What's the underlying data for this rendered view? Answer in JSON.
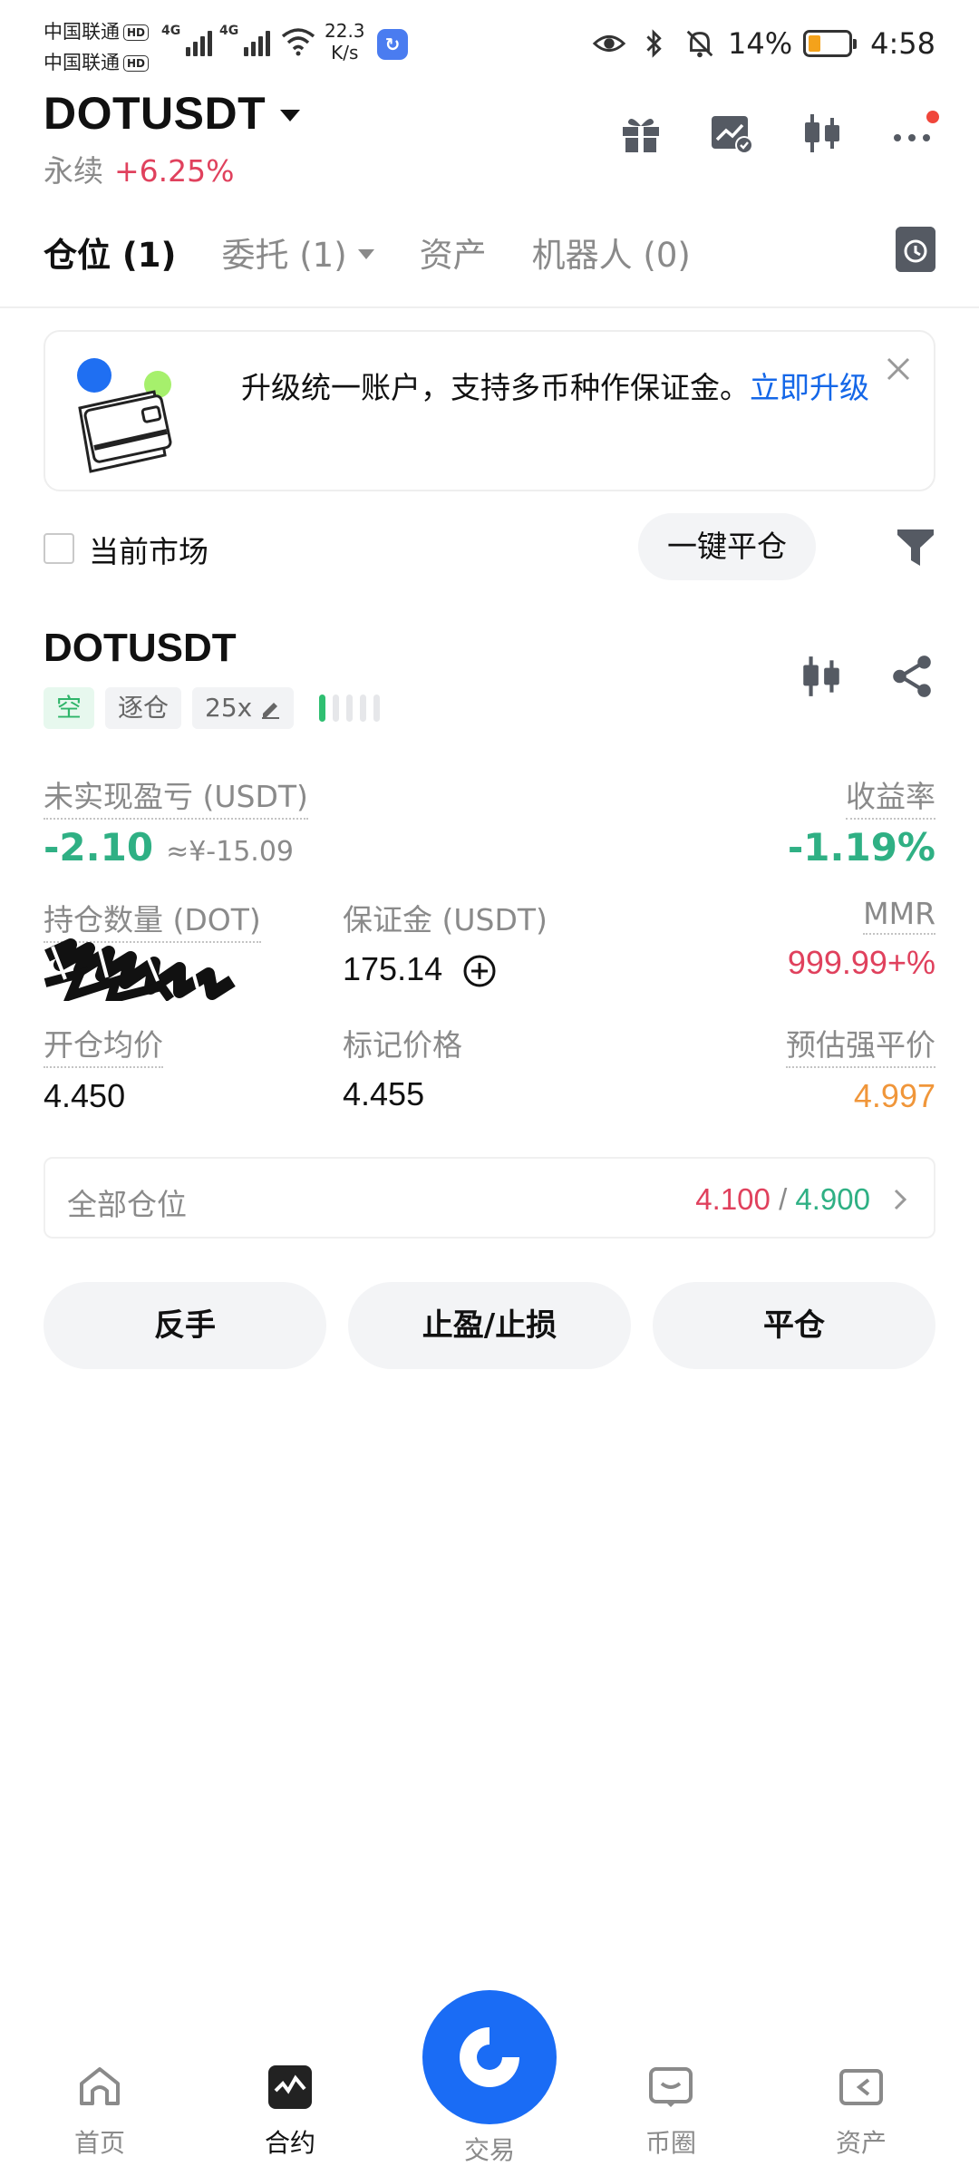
{
  "status_bar": {
    "carrier1": "中国联通",
    "carrier2": "中国联通",
    "hd": "HD",
    "net1": "4G",
    "net2": "4G",
    "speed_value": "22.3",
    "speed_unit": "K/s",
    "battery": "14%",
    "time": "4:58"
  },
  "header": {
    "symbol": "DOTUSDT",
    "contract_type": "永续",
    "change": "+6.25%"
  },
  "tabs": [
    {
      "label": "仓位 (1)",
      "active": true
    },
    {
      "label": "委托 (1)",
      "active": false
    },
    {
      "label": "资产",
      "active": false
    },
    {
      "label": "机器人 (0)",
      "active": false
    }
  ],
  "banner": {
    "text": "升级统一账户，支持多币种作保证金。",
    "link": "立即升级"
  },
  "filter": {
    "current_market": "当前市场",
    "close_all": "一键平仓"
  },
  "position": {
    "symbol": "DOTUSDT",
    "side": "空",
    "margin_mode": "逐仓",
    "leverage": "25x",
    "adl_level": 1,
    "unrealized_pnl_label": "未实现盈亏 (USDT)",
    "unrealized_pnl": "-2.10",
    "unrealized_pnl_cny": "≈¥-15.09",
    "roe_label": "收益率",
    "roe": "-1.19%",
    "size_label": "持仓数量 (DOT)",
    "margin_label": "保证金 (USDT)",
    "margin": "175.14",
    "mmr_label": "MMR",
    "mmr": "999.99+%",
    "entry_label": "开仓均价",
    "entry": "4.450",
    "mark_label": "标记价格",
    "mark": "4.455",
    "liq_label": "预估强平价",
    "liq": "4.997"
  },
  "all_positions": {
    "label": "全部仓位",
    "low": "4.100",
    "sep": "/",
    "high": "4.900"
  },
  "actions": {
    "reverse": "反手",
    "tp_sl": "止盈/止损",
    "close": "平仓"
  },
  "bottom_nav": [
    {
      "label": "首页",
      "icon": "home-icon"
    },
    {
      "label": "合约",
      "icon": "futures-icon"
    },
    {
      "label": "交易",
      "icon": "trade-icon"
    },
    {
      "label": "币圈",
      "icon": "community-icon"
    },
    {
      "label": "资产",
      "icon": "wallet-icon"
    }
  ],
  "colors": {
    "red": "#e0415d",
    "green": "#2fb084",
    "orange": "#f0963a",
    "blue": "#1a6cf5",
    "link": "#1467e8"
  }
}
